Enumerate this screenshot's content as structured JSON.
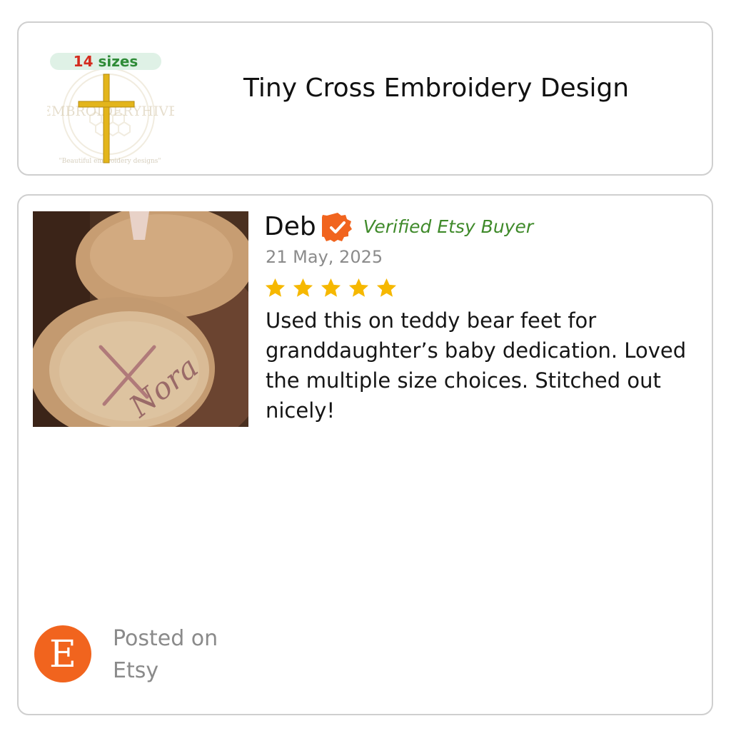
{
  "product": {
    "badge_number": "14",
    "badge_word": "sizes",
    "watermark_brand": "EMBROIDERYHIVE",
    "watermark_tagline": "\"Beautiful embroidery designs\"",
    "title": "Tiny Cross Embroidery Design"
  },
  "review": {
    "reviewer": "Deb",
    "verified_label": "Verified Etsy Buyer",
    "date": "21 May, 2025",
    "rating": 5,
    "text": "Used this on teddy bear feet for granddaughter’s baby dedication. Loved the multiple size choices. Stitched out nicely!",
    "photo_embroidered_name": "Nora",
    "source_logo_letter": "E",
    "posted_on": "Posted on Etsy"
  },
  "colors": {
    "star": "#f6b800",
    "verified_badge": "#f1641e",
    "verified_text": "#3f8a2a",
    "etsy_orange": "#f1641e",
    "cross_gold": "#e3b51b"
  }
}
